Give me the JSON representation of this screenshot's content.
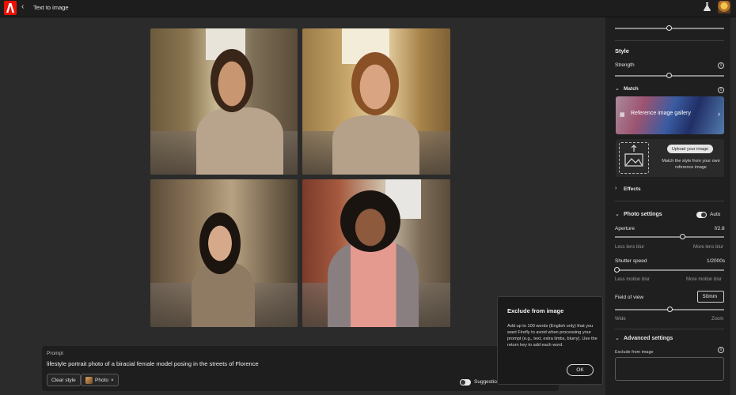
{
  "topbar": {
    "title": "Text to image",
    "back_glyph": "‹",
    "flask_icon": "flask-icon",
    "brand_color": "#eb1000"
  },
  "prompt": {
    "label": "Prompt",
    "text": "lifestyle portrait photo of a biracial female model posing in the streets of Florence",
    "clear_style": "Clear style",
    "chip_photo": "Photo",
    "chip_remove": "×",
    "suggestions_label": "Suggestion"
  },
  "tooltip": {
    "title": "Exclude from image",
    "body": "Add up to 100 words (English only) that you want Firefly to avoid when processing your prompt (e.g., text, extra limbs, blurry). Use the return key to add each word.",
    "ok": "OK"
  },
  "panel": {
    "style_heading": "Style",
    "strength_label": "Strength",
    "strength_level": 0.5,
    "match_label": "Match",
    "gallery_label": "Reference image gallery",
    "upload_button": "Upload your image",
    "upload_text": "Match the style from your own reference image",
    "effects_label": "Effects",
    "photo_settings_label": "Photo settings",
    "auto_label": "Auto",
    "aperture_label": "Aperture",
    "aperture_value": "f/2.8",
    "aperture_level": 0.62,
    "aperture_min": "Less lens blur",
    "aperture_max": "More lens blur",
    "shutter_label": "Shutter speed",
    "shutter_value": "1/2000s",
    "shutter_level": 0.02,
    "shutter_min": "Less motion blur",
    "shutter_max": "More motion blur",
    "fov_label": "Field of view",
    "fov_value": "50mm",
    "fov_level": 0.5,
    "fov_min": "Wide",
    "fov_max": "Zoom",
    "advanced_label": "Advanced settings",
    "exclude_label": "Exclude from image"
  }
}
